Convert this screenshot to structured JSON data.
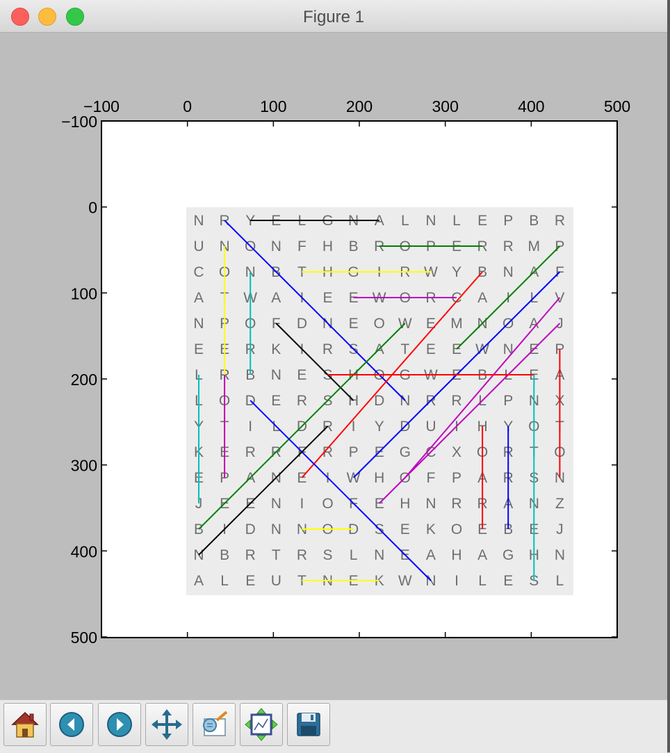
{
  "window": {
    "title": "Figure 1"
  },
  "plot": {
    "top_ticks": [
      "−100",
      "0",
      "100",
      "200",
      "300",
      "400",
      "500"
    ],
    "left_ticks": [
      "−100",
      "0",
      "100",
      "200",
      "300",
      "400",
      "500"
    ]
  },
  "grid": {
    "rows": [
      "NRYELGNALNLEPBR",
      "UNONFHBROPERRMP",
      "CONBTHGIRWYBNAF",
      "ATWAIEEWORCAILV",
      "NPOFDNEOWEMNOAJ",
      "EERKIRSATEEWNEP",
      "LRBNESHOGWEBLEA",
      "LODERSHDNRRLPNX",
      "YTILDRIYDUIHYOT",
      "KERRFRPEGCXORTO",
      "EPANEIWHOFPARSN",
      "JEENIOFEHNRRANZ",
      "BIDNNODSEKOEBEJ",
      "NBRTRSLNEAHAGHN",
      "ALEUTNEKWNILESL"
    ]
  },
  "toolbar": {
    "buttons": [
      {
        "name": "home-button",
        "icon": "home-icon"
      },
      {
        "name": "back-button",
        "icon": "arrow-left-icon"
      },
      {
        "name": "forward-button",
        "icon": "arrow-right-icon"
      },
      {
        "name": "pan-button",
        "icon": "move-icon"
      },
      {
        "name": "zoom-button",
        "icon": "zoom-rect-icon"
      },
      {
        "name": "subplots-button",
        "icon": "subplots-icon"
      },
      {
        "name": "save-button",
        "icon": "floppy-icon"
      }
    ]
  }
}
